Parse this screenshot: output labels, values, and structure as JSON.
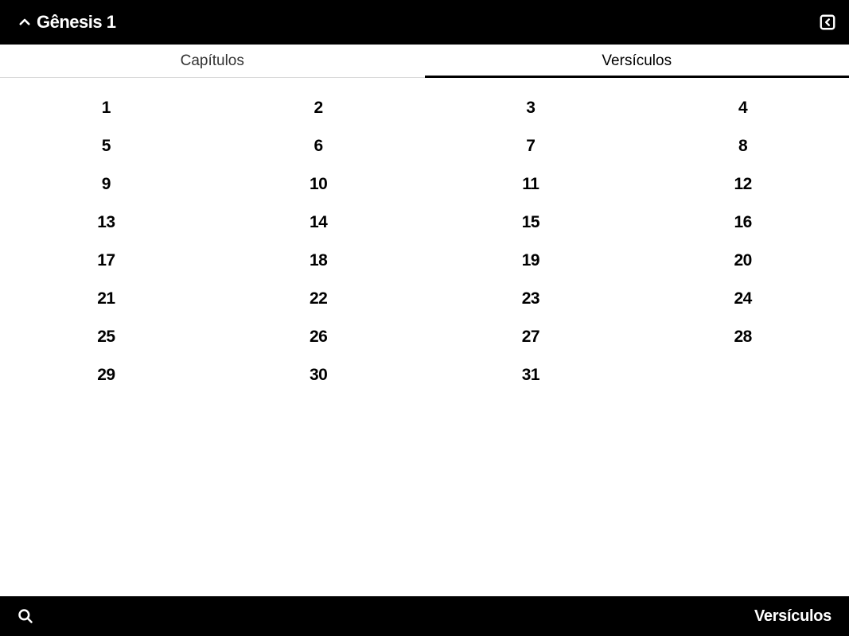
{
  "header": {
    "title": "Gênesis 1"
  },
  "tabs": {
    "left": "Capítulos",
    "right": "Versículos",
    "active": "right"
  },
  "verses": [
    1,
    2,
    3,
    4,
    5,
    6,
    7,
    8,
    9,
    10,
    11,
    12,
    13,
    14,
    15,
    16,
    17,
    18,
    19,
    20,
    21,
    22,
    23,
    24,
    25,
    26,
    27,
    28,
    29,
    30,
    31
  ],
  "footer": {
    "right_label": "Versículos"
  }
}
